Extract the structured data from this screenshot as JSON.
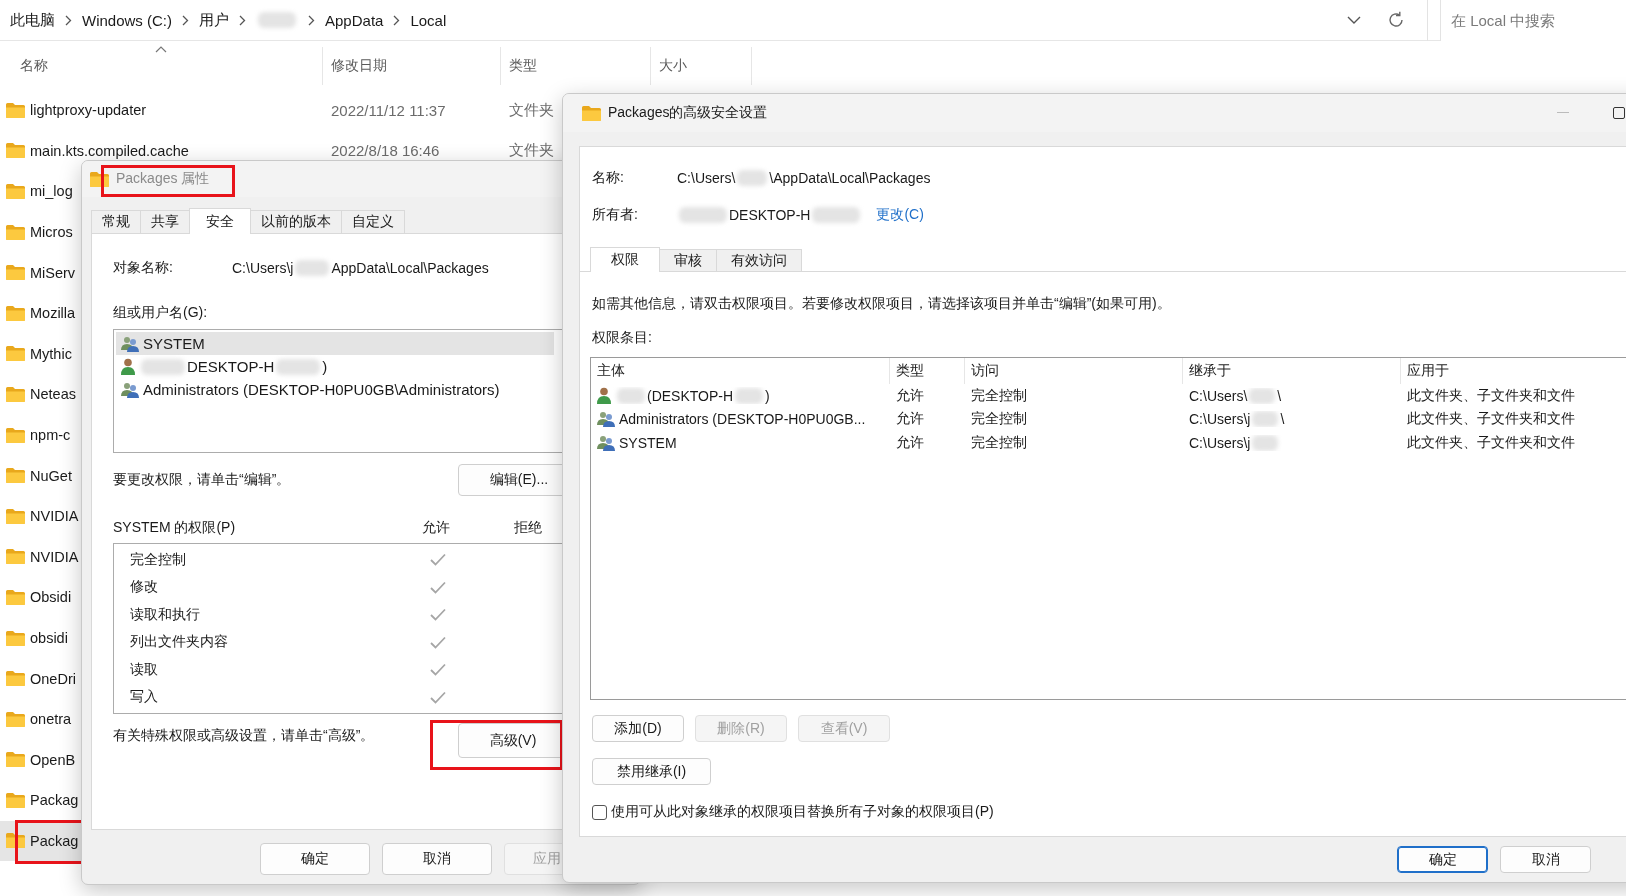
{
  "explorer": {
    "breadcrumb": [
      {
        "kind": "text",
        "text": "此电脑"
      },
      {
        "kind": "text",
        "text": "Windows (C:)"
      },
      {
        "kind": "text",
        "text": "用户"
      },
      {
        "kind": "redacted"
      },
      {
        "kind": "text",
        "text": "AppData"
      },
      {
        "kind": "text",
        "text": "Local"
      }
    ],
    "search": {
      "placeholder": "在 Local 中搜索"
    },
    "columns": [
      {
        "label": "名称",
        "sorted": true
      },
      {
        "label": "修改日期",
        "sorted": false
      },
      {
        "label": "类型",
        "sorted": false
      },
      {
        "label": "大小",
        "sorted": false
      }
    ],
    "rows": [
      {
        "name": "lightproxy-updater",
        "date": "2022/11/12 11:37",
        "type": "文件夹",
        "selected": false,
        "highlighted": false
      },
      {
        "name": "main.kts.compiled.cache",
        "date": "2022/8/18 16:46",
        "type": "文件夹",
        "selected": false,
        "highlighted": false
      },
      {
        "name": "mi_log",
        "selected": false,
        "highlighted": false
      },
      {
        "name": "Micros",
        "selected": false,
        "highlighted": false
      },
      {
        "name": "MiServ",
        "selected": false,
        "highlighted": false
      },
      {
        "name": "Mozilla",
        "selected": false,
        "highlighted": false
      },
      {
        "name": "Mythic",
        "selected": false,
        "highlighted": false
      },
      {
        "name": "Neteas",
        "selected": false,
        "highlighted": false
      },
      {
        "name": "npm-c",
        "selected": false,
        "highlighted": false
      },
      {
        "name": "NuGet",
        "selected": false,
        "highlighted": false
      },
      {
        "name": "NVIDIA",
        "selected": false,
        "highlighted": false
      },
      {
        "name": "NVIDIA",
        "selected": false,
        "highlighted": false
      },
      {
        "name": "Obsidi",
        "selected": false,
        "highlighted": false
      },
      {
        "name": "obsidi",
        "selected": false,
        "highlighted": false
      },
      {
        "name": "OneDri",
        "selected": false,
        "highlighted": false
      },
      {
        "name": "onetra",
        "selected": false,
        "highlighted": false
      },
      {
        "name": "OpenB",
        "selected": false,
        "highlighted": false
      },
      {
        "name": "Packag",
        "selected": false,
        "highlighted": false
      },
      {
        "name": "Packag",
        "selected": true,
        "highlighted": true
      }
    ]
  },
  "properties_dialog": {
    "title": "Packages 属性",
    "title_highlighted": true,
    "tabs": [
      {
        "label": "常规",
        "selected": false
      },
      {
        "label": "共享",
        "selected": false
      },
      {
        "label": "安全",
        "selected": true
      },
      {
        "label": "以前的版本",
        "selected": false
      },
      {
        "label": "自定义",
        "selected": false
      }
    ],
    "object_label": "对象名称:",
    "object_path": [
      {
        "kind": "text",
        "text": "C:\\Users\\j"
      },
      {
        "kind": "redacted"
      },
      {
        "kind": "text",
        "text": "AppData\\Local\\Packages"
      }
    ],
    "group_label": "组或用户名(G):",
    "principals": [
      {
        "kind": "group",
        "selected": true,
        "name": [
          {
            "kind": "text",
            "text": "SYSTEM"
          }
        ]
      },
      {
        "kind": "user",
        "selected": false,
        "name": [
          {
            "kind": "redacted"
          },
          {
            "kind": "text",
            "text": "DESKTOP-H"
          },
          {
            "kind": "redacted"
          },
          {
            "kind": "text",
            "text": ")"
          }
        ]
      },
      {
        "kind": "group",
        "selected": false,
        "name": [
          {
            "kind": "text",
            "text": "Administrators (DESKTOP-H0PU0GB\\Administrators)"
          }
        ]
      }
    ],
    "edit_hint": "要更改权限，请单击“编辑”。",
    "edit_button": "编辑(E)...",
    "permissions_title": "SYSTEM 的权限(P)",
    "allow_header": "允许",
    "deny_header": "拒绝",
    "permissions": [
      {
        "name": "完全控制",
        "allow": true,
        "deny": false
      },
      {
        "name": "修改",
        "allow": true,
        "deny": false
      },
      {
        "name": "读取和执行",
        "allow": true,
        "deny": false
      },
      {
        "name": "列出文件夹内容",
        "allow": true,
        "deny": false
      },
      {
        "name": "读取",
        "allow": true,
        "deny": false
      },
      {
        "name": "写入",
        "allow": true,
        "deny": false
      }
    ],
    "advanced_hint": "有关特殊权限或高级设置，请单击“高级”。",
    "advanced_button": {
      "label": "高级(V)",
      "highlighted": true
    },
    "buttons": [
      {
        "label": "确定",
        "disabled": false
      },
      {
        "label": "取消",
        "disabled": false
      },
      {
        "label": "应用",
        "disabled": true
      }
    ]
  },
  "advanced_dialog": {
    "title": "Packages的高级安全设置",
    "name_label": "名称:",
    "name_value": [
      {
        "kind": "text",
        "text": "C:\\Users\\"
      },
      {
        "kind": "redacted"
      },
      {
        "kind": "text",
        "text": "\\AppData\\Local\\Packages"
      }
    ],
    "owner_label": "所有者:",
    "owner_value": [
      {
        "kind": "redacted"
      },
      {
        "kind": "text",
        "text": "DESKTOP-H"
      },
      {
        "kind": "redacted"
      }
    ],
    "change_link": "更改(C)",
    "tabs": [
      {
        "label": "权限",
        "selected": true
      },
      {
        "label": "审核",
        "selected": false
      },
      {
        "label": "有效访问",
        "selected": false
      }
    ],
    "info": "如需其他信息，请双击权限项目。若要修改权限项目，请选择该项目并单击“编辑”(如果可用)。",
    "entries_label": "权限条目:",
    "columns": [
      "主体",
      "类型",
      "访问",
      "继承于",
      "应用于"
    ],
    "entries": [
      {
        "kind": "user",
        "principal": [
          {
            "kind": "redacted"
          },
          {
            "kind": "text",
            "text": "(DESKTOP-H"
          },
          {
            "kind": "redacted"
          },
          {
            "kind": "text",
            "text": ")"
          }
        ],
        "type": "允许",
        "access": "完全控制",
        "inherited_from": [
          {
            "kind": "text",
            "text": "C:\\Users\\"
          },
          {
            "kind": "redacted"
          },
          {
            "kind": "text",
            "text": "\\"
          }
        ],
        "applies_to": "此文件夹、子文件夹和文件"
      },
      {
        "kind": "group",
        "principal": [
          {
            "kind": "text",
            "text": "Administrators (DESKTOP-H0PU0GB..."
          }
        ],
        "type": "允许",
        "access": "完全控制",
        "inherited_from": [
          {
            "kind": "text",
            "text": "C:\\Users\\j"
          },
          {
            "kind": "redacted"
          },
          {
            "kind": "text",
            "text": "\\"
          }
        ],
        "applies_to": "此文件夹、子文件夹和文件"
      },
      {
        "kind": "group",
        "principal": [
          {
            "kind": "text",
            "text": "SYSTEM"
          }
        ],
        "type": "允许",
        "access": "完全控制",
        "inherited_from": [
          {
            "kind": "text",
            "text": "C:\\Users\\j"
          },
          {
            "kind": "redacted"
          }
        ],
        "applies_to": "此文件夹、子文件夹和文件"
      }
    ],
    "entry_buttons": [
      {
        "label": "添加(D)",
        "disabled": false
      },
      {
        "label": "删除(R)",
        "disabled": true
      },
      {
        "label": "查看(V)",
        "disabled": true
      }
    ],
    "inheritance_button": "禁用继承(I)",
    "replace_checkbox": {
      "label": "使用可从此对象继承的权限项目替换所有子对象的权限项目(P)",
      "checked": false
    },
    "footer_buttons": [
      {
        "label": "确定",
        "default": true
      },
      {
        "label": "取消",
        "default": false
      }
    ]
  }
}
